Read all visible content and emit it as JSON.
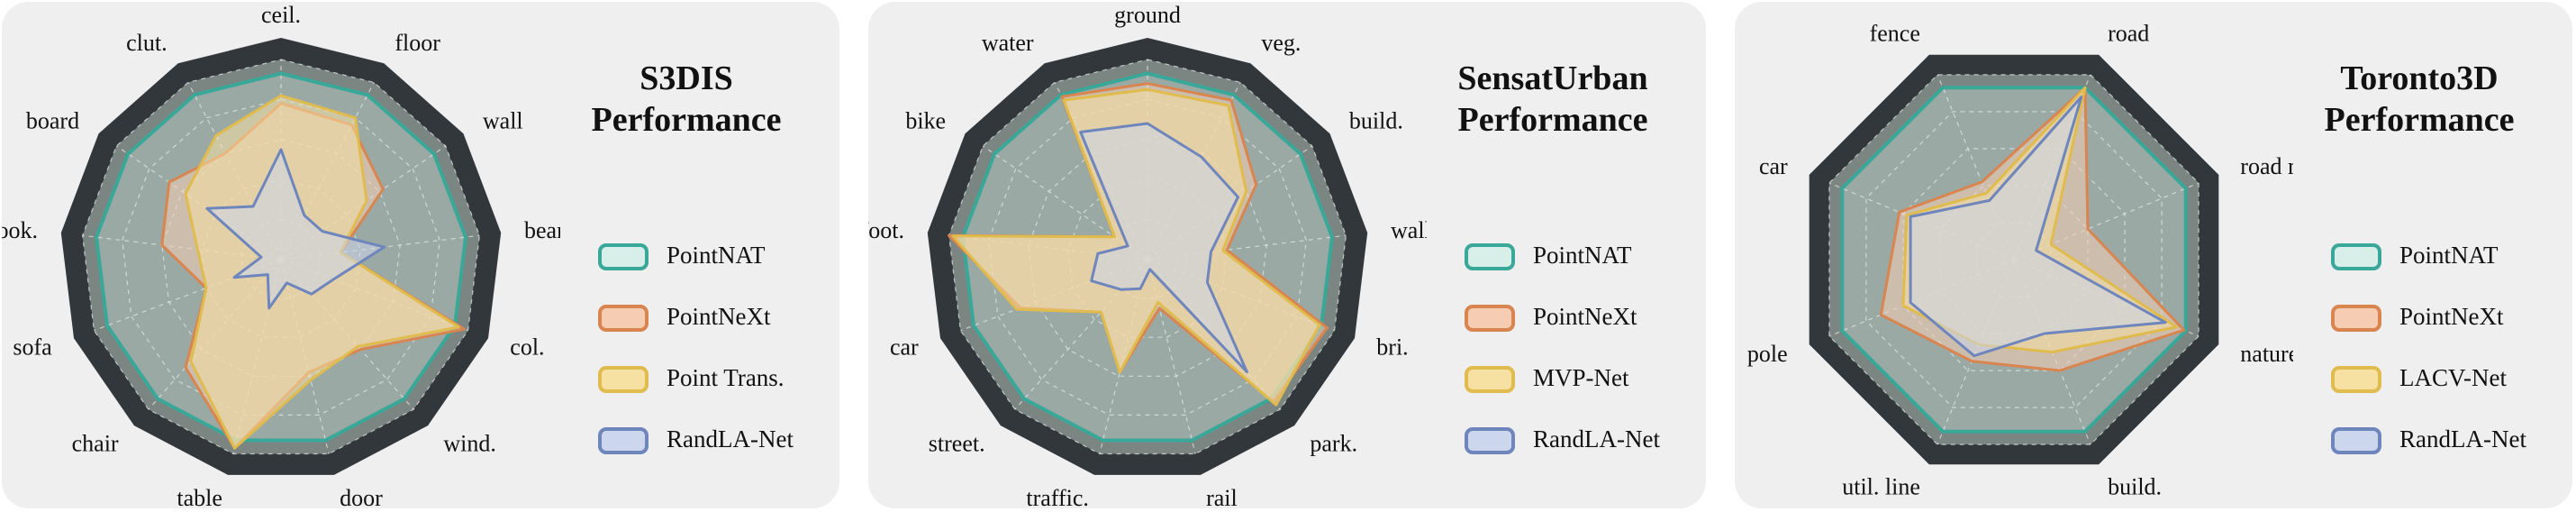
{
  "colors": {
    "outer_band": "#31373b",
    "outer_fill": "#7b8581",
    "grid": "#e6e6e6",
    "series": [
      "#3aa898",
      "#d98550",
      "#e0bb4d",
      "#6f86bd"
    ],
    "series_fill": [
      "#d8eee8",
      "#f6cdb2",
      "#f6e0a2",
      "#ccd6ec"
    ]
  },
  "chart_data": [
    {
      "type": "radar",
      "title": "S3DIS Performance",
      "title_lines": [
        "S3DIS",
        "Performance"
      ],
      "categories": [
        "ceil.",
        "floor",
        "wall",
        "beam",
        "col.",
        "wind.",
        "door",
        "table",
        "chair",
        "sofa",
        "book.",
        "board",
        "clut."
      ],
      "range": [
        0,
        1
      ],
      "grid_levels": 5,
      "grid": true,
      "legend_position": "right",
      "series": [
        {
          "name": "PointNAT",
          "values": [
            0.93,
            0.93,
            0.93,
            0.93,
            0.93,
            0.93,
            0.93,
            0.93,
            0.93,
            0.93,
            0.93,
            0.93,
            0.93
          ]
        },
        {
          "name": "PointNeXt",
          "values": [
            0.78,
            0.76,
            0.62,
            0.3,
            0.98,
            0.6,
            0.58,
            0.97,
            0.72,
            0.4,
            0.6,
            0.68,
            0.6
          ]
        },
        {
          "name": "Point Trans.",
          "values": [
            0.82,
            0.8,
            0.52,
            0.3,
            0.95,
            0.58,
            0.62,
            0.97,
            0.68,
            0.4,
            0.42,
            0.58,
            0.7
          ]
        },
        {
          "name": "RandLA-Net",
          "values": [
            0.55,
            0.25,
            0.25,
            0.52,
            0.28,
            0.23,
            0.12,
            0.25,
            0.1,
            0.25,
            0.1,
            0.45,
            0.3
          ]
        }
      ]
    },
    {
      "type": "radar",
      "title": "SensatUrban Performance",
      "title_lines": [
        "SensatUrban",
        "Performance"
      ],
      "categories": [
        "ground",
        "veg.",
        "build.",
        "wall",
        "bri.",
        "park.",
        "rail",
        "traffic.",
        "street.",
        "car",
        "foot.",
        "bike",
        "water"
      ],
      "range": [
        0,
        1
      ],
      "grid_levels": 5,
      "grid": true,
      "legend_position": "right",
      "series": [
        {
          "name": "PointNAT",
          "values": [
            0.93,
            0.93,
            0.93,
            0.93,
            0.93,
            0.93,
            0.93,
            0.93,
            0.93,
            0.93,
            0.93,
            0.93,
            0.93
          ]
        },
        {
          "name": "PointNeXt",
          "values": [
            0.88,
            0.9,
            0.66,
            0.4,
            0.96,
            0.95,
            0.25,
            0.58,
            0.35,
            0.68,
            1.0,
            0.2,
            0.92
          ]
        },
        {
          "name": "MVP-Net",
          "values": [
            0.85,
            0.87,
            0.6,
            0.38,
            0.92,
            0.97,
            0.22,
            0.58,
            0.35,
            0.7,
            0.98,
            0.2,
            0.9
          ]
        },
        {
          "name": "RandLA-Net",
          "values": [
            0.68,
            0.58,
            0.55,
            0.32,
            0.32,
            0.75,
            0.05,
            0.15,
            0.2,
            0.3,
            0.25,
            0.12,
            0.72
          ]
        }
      ]
    },
    {
      "type": "radar",
      "title": "Toronto3D Performance",
      "title_lines": [
        "Toronto3D",
        "Performance"
      ],
      "categories": [
        "road",
        "road mrk.",
        "nature",
        "build.",
        "util. line",
        "pole",
        "car",
        "fence"
      ],
      "range": [
        0,
        1
      ],
      "grid_levels": 5,
      "grid": true,
      "legend_position": "right",
      "series": [
        {
          "name": "PointNAT",
          "values": [
            0.93,
            0.93,
            0.93,
            0.93,
            0.93,
            0.93,
            0.93,
            0.93
          ]
        },
        {
          "name": "PointNeXt",
          "values": [
            0.93,
            0.4,
            0.92,
            0.6,
            0.55,
            0.72,
            0.62,
            0.42
          ]
        },
        {
          "name": "LACV-Net",
          "values": [
            0.93,
            0.2,
            0.88,
            0.5,
            0.46,
            0.6,
            0.58,
            0.36
          ]
        },
        {
          "name": "RandLA-Net",
          "values": [
            0.88,
            0.12,
            0.82,
            0.4,
            0.52,
            0.56,
            0.56,
            0.32
          ]
        }
      ]
    }
  ]
}
